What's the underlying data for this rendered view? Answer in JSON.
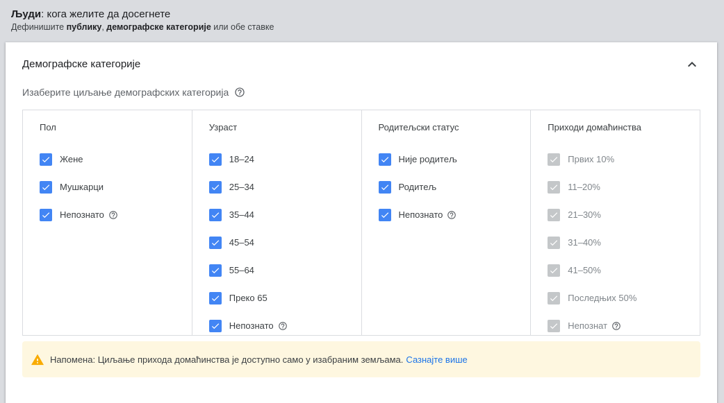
{
  "header": {
    "title_bold": "Људи",
    "title_rest": ": кога желите да досегнете",
    "sub_prefix": "Дефинишите ",
    "sub_bold1": "публику",
    "sub_sep": ", ",
    "sub_bold2": "демографске категорије",
    "sub_suffix": " или обе ставке"
  },
  "card": {
    "title": "Демографске категорије",
    "subtitle": "Изаберите циљање демографских категорија"
  },
  "columns": {
    "gender": {
      "header": "Пол",
      "items": [
        "Жене",
        "Мушкарци",
        "Непознато"
      ]
    },
    "age": {
      "header": "Узраст",
      "items": [
        "18–24",
        "25–34",
        "35–44",
        "45–54",
        "55–64",
        "Преко 65",
        "Непознато"
      ]
    },
    "parental": {
      "header": "Родитељски статус",
      "items": [
        "Није родитељ",
        "Родитељ",
        "Непознато"
      ]
    },
    "income": {
      "header": "Приходи домаћинства",
      "items": [
        "Првих 10%",
        "11–20%",
        "21–30%",
        "31–40%",
        "41–50%",
        "Последњих 50%",
        "Непознат"
      ]
    }
  },
  "notice": {
    "text": "Напомена: Циљање прихода домаћинства је доступно само у изабраним земљама.",
    "link": "Сазнајте више"
  },
  "colors": {
    "checkbox_active": "#4285f4",
    "checkbox_disabled": "#c4c7c9",
    "link": "#1a73e8",
    "notice_bg": "#fef7e0",
    "warning": "#f9ab00"
  },
  "icons": {
    "collapse": "chevron-up-icon",
    "help": "help-circle-icon",
    "check": "check-icon",
    "warning": "warning-icon"
  }
}
